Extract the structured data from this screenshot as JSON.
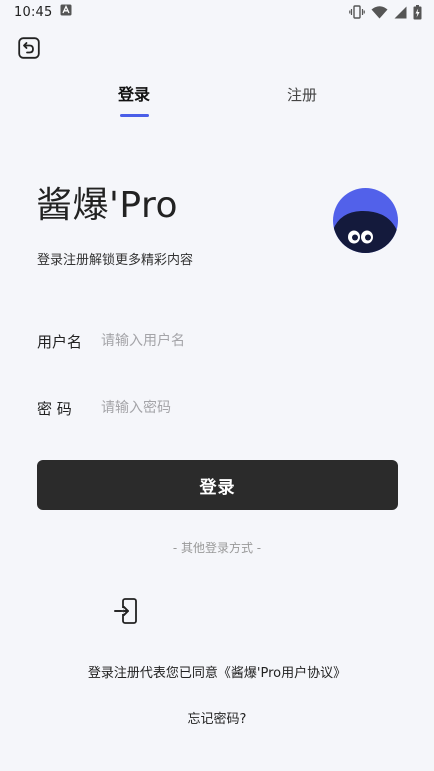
{
  "status_bar": {
    "time": "10:45",
    "icons": [
      "notification-a-icon",
      "vibrate-icon",
      "wifi-icon",
      "signal-icon",
      "battery-charging-icon"
    ]
  },
  "nav": {
    "back_icon": "back-arrow-icon"
  },
  "tabs": [
    {
      "label": "登录",
      "active": true
    },
    {
      "label": "注册",
      "active": false
    }
  ],
  "brand": {
    "title": "酱爆'Pro",
    "subtitle": "登录注册解锁更多精彩内容",
    "avatar_icon": "mascot-avatar-icon",
    "accent": "#4a5ee8"
  },
  "form": {
    "username_label": "用户名",
    "username_placeholder": "请输入用户名",
    "username_value": "",
    "password_label": "密 码",
    "password_placeholder": "请输入密码",
    "password_value": ""
  },
  "login_button": {
    "label": "登录",
    "color": "#2b2b2b"
  },
  "other_login": {
    "label": "- 其他登录方式 -",
    "icon": "login-entry-icon"
  },
  "agreement": {
    "text": "登录注册代表您已同意《酱爆'Pro用户协议》"
  },
  "forgot_password": {
    "label": "忘记密码?"
  }
}
